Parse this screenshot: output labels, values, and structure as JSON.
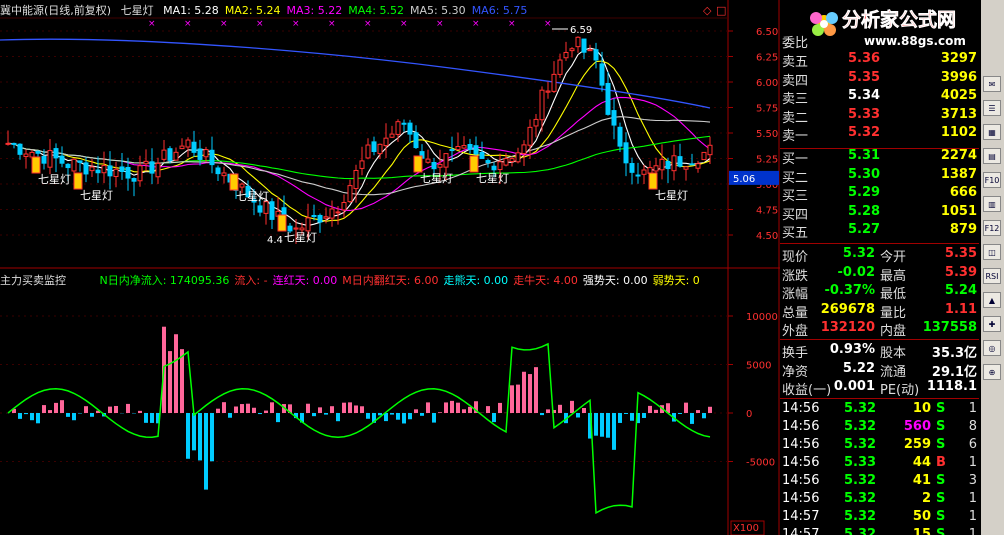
{
  "header": {
    "stock_name": "冀中能源(日线,前复权)",
    "indicator_name": "七星灯",
    "ma": [
      {
        "label": "MA1: 5.28",
        "color": "#ffffff"
      },
      {
        "label": "MA2: 5.24",
        "color": "#ffff00"
      },
      {
        "label": "MA3: 5.22",
        "color": "#ff00ff"
      },
      {
        "label": "MA4: 5.52",
        "color": "#00ff00"
      },
      {
        "label": "MA5: 5.30",
        "color": "#cccccc"
      },
      {
        "label": "MA6: 5.75",
        "color": "#3355ff"
      }
    ]
  },
  "price_axis": {
    "ticks": [
      "6.50",
      "6.25",
      "6.00",
      "5.75",
      "5.50",
      "5.25",
      "5.00",
      "4.75",
      "4.50"
    ],
    "current": "5.06"
  },
  "annotations": {
    "high": "6.59",
    "low": "4.4",
    "signal_label": "七星灯"
  },
  "indicator": {
    "title": "主力买卖监控",
    "items": [
      {
        "label": "N日内净流入: 174095.36",
        "color": "#00ff00"
      },
      {
        "label": "流入: -",
        "color": "#ff3030"
      },
      {
        "label": "连红天: 0.00",
        "color": "#ff00ff"
      },
      {
        "label": "M日内翻红天: 6.00",
        "color": "#ff3030"
      },
      {
        "label": "走熊天: 0.00",
        "color": "#00ffff"
      },
      {
        "label": "走牛天: 4.00",
        "color": "#ff3030"
      },
      {
        "label": "强势天: 0.00",
        "color": "#ffffff"
      },
      {
        "label": "弱势天: 0",
        "color": "#ffff00"
      }
    ],
    "axis_ticks": [
      "10000",
      "5000",
      "0",
      "-5000"
    ],
    "multiplier": "X100"
  },
  "quote": {
    "partial_label": "委比",
    "sell": [
      {
        "label": "卖五",
        "price": "5.36",
        "vol": "3297"
      },
      {
        "label": "卖四",
        "price": "5.35",
        "vol": "3996"
      },
      {
        "label": "卖三",
        "price": "5.34",
        "vol": "4025"
      },
      {
        "label": "卖二",
        "price": "5.33",
        "vol": "3713"
      },
      {
        "label": "卖一",
        "price": "5.32",
        "vol": "1102"
      }
    ],
    "buy": [
      {
        "label": "买一",
        "price": "5.31",
        "vol": "2274"
      },
      {
        "label": "买二",
        "price": "5.30",
        "vol": "1387"
      },
      {
        "label": "买三",
        "price": "5.29",
        "vol": "666"
      },
      {
        "label": "买四",
        "price": "5.28",
        "vol": "1051"
      },
      {
        "label": "买五",
        "price": "5.27",
        "vol": "879"
      }
    ],
    "stats": [
      {
        "l1": "现价",
        "v1": "5.32",
        "l2": "今开",
        "v2": "5.35",
        "c1": "#00ff00",
        "c2": "#ff3030"
      },
      {
        "l1": "涨跌",
        "v1": "-0.02",
        "l2": "最高",
        "v2": "5.39",
        "c1": "#00ff00",
        "c2": "#ff3030"
      },
      {
        "l1": "涨幅",
        "v1": "-0.37%",
        "l2": "最低",
        "v2": "5.24",
        "c1": "#00ff00",
        "c2": "#00ff00"
      },
      {
        "l1": "总量",
        "v1": "269678",
        "l2": "量比",
        "v2": "1.11",
        "c1": "#ffff00",
        "c2": "#ff3030"
      },
      {
        "l1": "外盘",
        "v1": "132120",
        "l2": "内盘",
        "v2": "137558",
        "c1": "#ff3030",
        "c2": "#00ff00"
      }
    ],
    "stats2": [
      {
        "l1": "换手",
        "v1": "0.93%",
        "l2": "股本",
        "v2": "35.3亿"
      },
      {
        "l1": "净资",
        "v1": "5.22",
        "l2": "流通",
        "v2": "29.1亿"
      },
      {
        "l1": "收益(一)",
        "v1": "0.001",
        "l2": "PE(动)",
        "v2": "1118.1"
      }
    ],
    "ticks": [
      {
        "time": "14:56",
        "price": "5.32",
        "vol": "10",
        "bs": "S",
        "n": "1",
        "vc": "#ffff00",
        "bc": "#00ff00"
      },
      {
        "time": "14:56",
        "price": "5.32",
        "vol": "560",
        "bs": "S",
        "n": "8",
        "vc": "#ff00ff",
        "bc": "#00ff00"
      },
      {
        "time": "14:56",
        "price": "5.32",
        "vol": "259",
        "bs": "S",
        "n": "6",
        "vc": "#ffff00",
        "bc": "#00ff00"
      },
      {
        "time": "14:56",
        "price": "5.33",
        "vol": "44",
        "bs": "B",
        "n": "1",
        "vc": "#ffff00",
        "bc": "#ff3030"
      },
      {
        "time": "14:56",
        "price": "5.32",
        "vol": "41",
        "bs": "S",
        "n": "3",
        "vc": "#ffff00",
        "bc": "#00ff00"
      },
      {
        "time": "14:56",
        "price": "5.32",
        "vol": "2",
        "bs": "S",
        "n": "1",
        "vc": "#ffff00",
        "bc": "#00ff00"
      },
      {
        "time": "14:57",
        "price": "5.32",
        "vol": "50",
        "bs": "S",
        "n": "1",
        "vc": "#ffff00",
        "bc": "#00ff00"
      },
      {
        "time": "14:57",
        "price": "5.32",
        "vol": "15",
        "bs": "S",
        "n": "1",
        "vc": "#ffff00",
        "bc": "#00ff00"
      }
    ]
  },
  "watermark": {
    "brand": "分析家公式网",
    "url": "www.88gs.com"
  },
  "toolbar": [
    "✉",
    "☰",
    "▦",
    "▤",
    "F10",
    "▥",
    "F12",
    "◫",
    "RSI",
    "▲",
    "✚",
    "◎",
    "⊕"
  ]
}
